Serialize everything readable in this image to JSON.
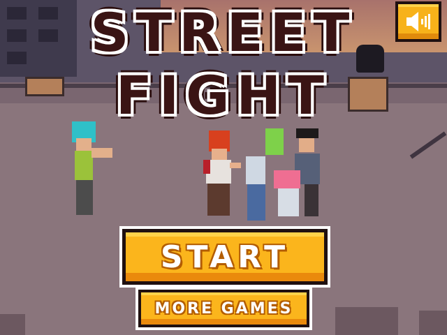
{
  "game": {
    "title_line1": "STREET",
    "title_line2": "FIGHT"
  },
  "buttons": {
    "start_label": "START",
    "more_games_label": "MORE GAMES",
    "sound_icon": "speaker-icon"
  },
  "colors": {
    "button_fill": "#fbb51c",
    "button_shadow": "#ea8a0c",
    "title_color": "#3a1414",
    "outline": "#1f1010"
  }
}
